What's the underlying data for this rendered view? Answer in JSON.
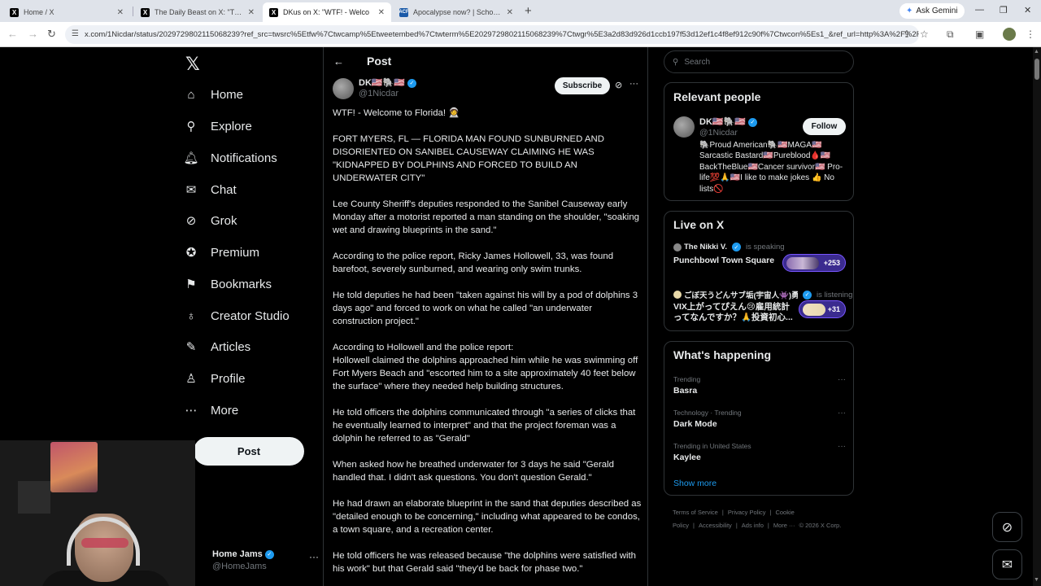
{
  "browser": {
    "tabs": [
      {
        "title": "Home / X",
        "favicon": "X",
        "active": false
      },
      {
        "title": "The Daily Beast on X: \"The fam",
        "favicon": "X",
        "active": false
      },
      {
        "title": "DKus on X: \"WTF! - Welco",
        "favicon": "X",
        "active": true
      },
      {
        "title": "Apocalypse now? | School of So",
        "favicon": "ACF",
        "active": false
      }
    ],
    "ask_gemini": "Ask Gemini",
    "url": "x.com/1Nicdar/status/2029729802115068239?ref_src=twsrc%5Etfw%7Ctwcamp%5Etweetembed%7Ctwterm%5E2029729802115068239%7Ctwgr%5E3a2d83d926d1ccb197f53d12ef1c4f8ef912c90f%7Ctwcon%5Es1_&ref_url=http%3A%2F%2F..."
  },
  "nav": {
    "items": [
      {
        "label": "Home",
        "icon": "home-icon",
        "glyph": "⌂"
      },
      {
        "label": "Explore",
        "icon": "search-icon",
        "glyph": "⚲"
      },
      {
        "label": "Notifications",
        "icon": "bell-icon",
        "glyph": "🔔︎"
      },
      {
        "label": "Chat",
        "icon": "mail-icon",
        "glyph": "✉"
      },
      {
        "label": "Grok",
        "icon": "grok-icon",
        "glyph": "⊘"
      },
      {
        "label": "Premium",
        "icon": "premium-icon",
        "glyph": "✪"
      },
      {
        "label": "Bookmarks",
        "icon": "bookmark-icon",
        "glyph": "⚑"
      },
      {
        "label": "Creator Studio",
        "icon": "flask-icon",
        "glyph": "♁"
      },
      {
        "label": "Articles",
        "icon": "article-icon",
        "glyph": "✎"
      },
      {
        "label": "Profile",
        "icon": "person-icon",
        "glyph": "♙"
      },
      {
        "label": "More",
        "icon": "more-circle-icon",
        "glyph": "⋯"
      }
    ],
    "post_label": "Post",
    "account": {
      "name": "Home Jams",
      "handle": "@HomeJams"
    }
  },
  "post": {
    "header_title": "Post",
    "author_name": "DK🇺🇸🐘🇺🇸",
    "author_handle": "@1Nicdar",
    "subscribe_label": "Subscribe",
    "paragraphs": [
      "WTF! - Welcome to Florida! 🧑‍🚀",
      "FORT MYERS, FL — FLORIDA MAN FOUND SUNBURNED AND DISORIENTED ON SANIBEL CAUSEWAY CLAIMING HE WAS \"KIDNAPPED BY DOLPHINS AND FORCED TO BUILD AN UNDERWATER CITY\"",
      "Lee County Sheriff's deputies responded to the Sanibel Causeway early Monday after a motorist reported a man standing on the shoulder, \"soaking wet and drawing blueprints in the sand.\"",
      "According to the police report, Ricky James Hollowell, 33, was found barefoot, severely sunburned, and wearing only swim trunks.",
      "He told deputies he had been \"taken against his will by a pod of dolphins 3 days ago\" and forced to work on what he called \"an underwater construction project.\"",
      "According to Hollowell and the police report:\nHollowell claimed the dolphins approached him while he was swimming off Fort Myers Beach and \"escorted him to a site approximately 40 feet below the surface\" where they needed help building structures.",
      "He told officers the dolphins communicated through \"a series of clicks that he eventually learned to interpret\" and that the project foreman was a dolphin he referred to as \"Gerald\"",
      "When asked how he breathed underwater for 3 days he said \"Gerald handled that. I didn't ask questions. You don't question Gerald.\"",
      "He had drawn an elaborate blueprint in the sand that deputies described as \"detailed enough to be concerning,\" including what appeared to be condos, a town square, and a recreation center.",
      "He told officers he was released because \"the dolphins were satisfied with his work\" but that Gerald said \"they'd be back for phase two.\""
    ]
  },
  "sidebar": {
    "search_placeholder": "Search",
    "relevant_people": {
      "title": "Relevant people",
      "name": "DK🇺🇸🐘🇺🇸",
      "handle": "@1Nicdar",
      "follow_label": "Follow",
      "bio": "🐘Proud American🐘🇺🇸MAGA🇺🇸 Sarcastic Bastard🇺🇸Pureblood🩸🇺🇸 BackTheBlue🇺🇸Cancer survivor🇺🇸 Pro-life💯🙏🇺🇸I like to make jokes 👍 No lists🚫"
    },
    "live": {
      "title": "Live on X",
      "spaces": [
        {
          "host": "The Nikki V.",
          "status": "is speaking",
          "title": "Punchbowl Town Square",
          "count": "+253"
        },
        {
          "host": "ごぼ天うどんサブ垢(宇宙人👾)勇...",
          "status": "is listening",
          "title": "VIX上がってぴえん😢雇用統計ってなんですか？🙏投資初心...",
          "count": "+31"
        }
      ]
    },
    "happening": {
      "title": "What's happening",
      "trends": [
        {
          "context": "Trending",
          "topic": "Basra"
        },
        {
          "context": "Technology · Trending",
          "topic": "Dark Mode"
        },
        {
          "context": "Trending in United States",
          "topic": "Kaylee"
        }
      ],
      "show_more": "Show more"
    },
    "footer": [
      "Terms of Service",
      "|",
      "Privacy Policy",
      "|",
      "Cookie Policy",
      "|",
      "Accessibility",
      "|",
      "Ads info",
      "|",
      "More ···",
      "© 2026 X Corp."
    ]
  },
  "colors": {
    "accent": "#1d9bf0",
    "background": "#000000",
    "text": "#e7e9ea",
    "muted": "#71767b",
    "border": "#2f3336"
  }
}
